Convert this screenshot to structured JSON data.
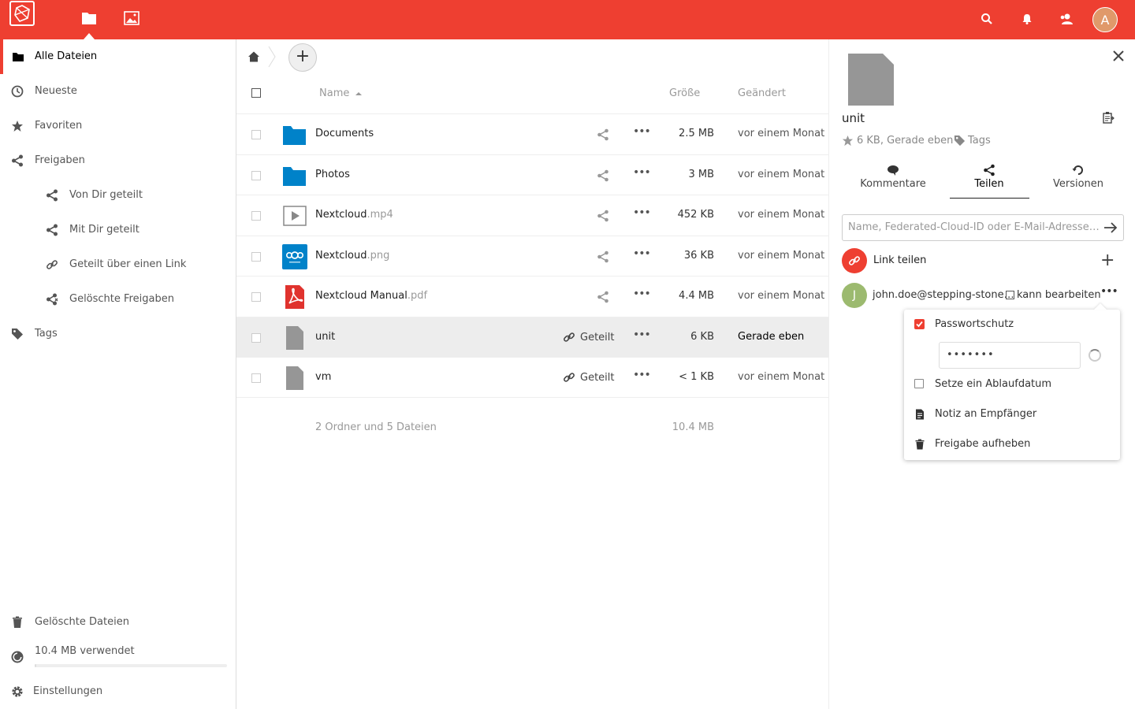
{
  "header": {
    "avatar_letter": "A",
    "accent_color": "#ee3f31"
  },
  "sidebar": {
    "items": [
      {
        "label": "Alle Dateien",
        "icon": "folder-icon"
      },
      {
        "label": "Neueste",
        "icon": "clock-icon"
      },
      {
        "label": "Favoriten",
        "icon": "star-icon"
      },
      {
        "label": "Freigaben",
        "icon": "share-icon"
      },
      {
        "label": "Von Dir geteilt",
        "icon": "share-icon"
      },
      {
        "label": "Mit Dir geteilt",
        "icon": "share-icon"
      },
      {
        "label": "Geteilt über einen Link",
        "icon": "link-icon"
      },
      {
        "label": "Gelöschte Freigaben",
        "icon": "share-deleted-icon"
      },
      {
        "label": "Tags",
        "icon": "tag-icon"
      }
    ],
    "deleted_files": "Gelöschte Dateien",
    "quota_text": "10.4 MB verwendet",
    "quota_fraction": 0.0,
    "settings": "Einstellungen"
  },
  "files": {
    "columns": {
      "name": "Name",
      "size": "Größe",
      "modified": "Geändert"
    },
    "rows": [
      {
        "name": "Documents",
        "ext": "",
        "size": "2.5 MB",
        "modified": "vor einem Monat",
        "type": "folder",
        "shared": ""
      },
      {
        "name": "Photos",
        "ext": "",
        "size": "3 MB",
        "modified": "vor einem Monat",
        "type": "folder",
        "shared": ""
      },
      {
        "name": "Nextcloud",
        "ext": ".mp4",
        "size": "452 KB",
        "modified": "vor einem Monat",
        "type": "video",
        "shared": ""
      },
      {
        "name": "Nextcloud",
        "ext": ".png",
        "size": "36 KB",
        "modified": "vor einem Monat",
        "type": "image",
        "shared": ""
      },
      {
        "name": "Nextcloud Manual",
        "ext": ".pdf",
        "size": "4.4 MB",
        "modified": "vor einem Monat",
        "type": "pdf",
        "shared": ""
      },
      {
        "name": "unit",
        "ext": "",
        "size": "6 KB",
        "modified": "Gerade eben",
        "type": "file",
        "shared": "Geteilt"
      },
      {
        "name": "vm",
        "ext": "",
        "size": "< 1 KB",
        "modified": "vor einem Monat",
        "type": "file",
        "shared": "Geteilt"
      }
    ],
    "summary_text": "2 Ordner und 5 Dateien",
    "summary_size": "10.4 MB"
  },
  "details": {
    "title": "unit",
    "meta": "6 KB, Gerade eben",
    "tags": "Tags",
    "tabs": [
      "Kommentare",
      "Teilen",
      "Versionen"
    ],
    "share_placeholder": "Name, Federated-Cloud-ID oder E-Mail-Adresse…",
    "link_share": "Link teilen",
    "user_initial": "J",
    "user": "john.doe@stepping-stone…",
    "can_edit": "kann bearbeiten",
    "menu": {
      "password_protect": "Passwortschutz",
      "password_value": "•••••••",
      "expiry": "Setze ein Ablaufdatum",
      "note": "Notiz an Empfänger",
      "unshare": "Freigabe aufheben"
    }
  }
}
